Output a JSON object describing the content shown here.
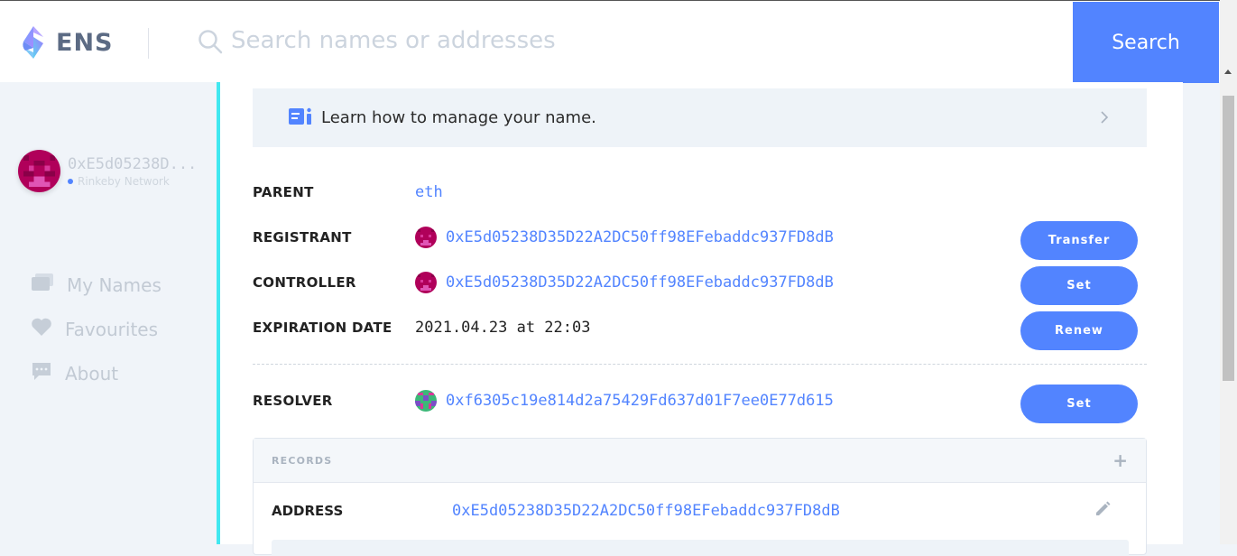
{
  "header": {
    "logo_text": "ENS",
    "search_placeholder": "Search names or addresses",
    "search_button": "Search"
  },
  "sidebar": {
    "account_address": "0xE5d05238D...",
    "network": "Rinkeby Network",
    "items": [
      {
        "label": "My Names",
        "icon": "cards-icon"
      },
      {
        "label": "Favourites",
        "icon": "heart-icon"
      },
      {
        "label": "About",
        "icon": "chat-bubble-icon"
      }
    ]
  },
  "banner": {
    "text": "Learn how to manage your name.",
    "icon": "book-icon"
  },
  "details": {
    "parent": {
      "label": "PARENT",
      "value": "eth"
    },
    "registrant": {
      "label": "REGISTRANT",
      "value": "0xE5d05238D35D22A2DC50ff98EFebaddc937FD8dB",
      "action": "Transfer"
    },
    "controller": {
      "label": "CONTROLLER",
      "value": "0xE5d05238D35D22A2DC50ff98EFebaddc937FD8dB",
      "action": "Set"
    },
    "expiration": {
      "label": "EXPIRATION DATE",
      "value": "2021.04.23 at 22:03",
      "action": "Renew"
    },
    "resolver": {
      "label": "RESOLVER",
      "value": "0xf6305c19e814d2a75429Fd637d01F7ee0E77d615",
      "action": "Set"
    }
  },
  "records": {
    "title": "RECORDS",
    "plus": "+",
    "rows": [
      {
        "label": "ADDRESS",
        "value": "0xE5d05238D35D22A2DC50ff98EFebaddc937FD8dB"
      }
    ]
  },
  "colors": {
    "accent": "#5284ff",
    "cyan_bar": "#42e8f0",
    "sidebar_bg": "#f0f4f9"
  }
}
